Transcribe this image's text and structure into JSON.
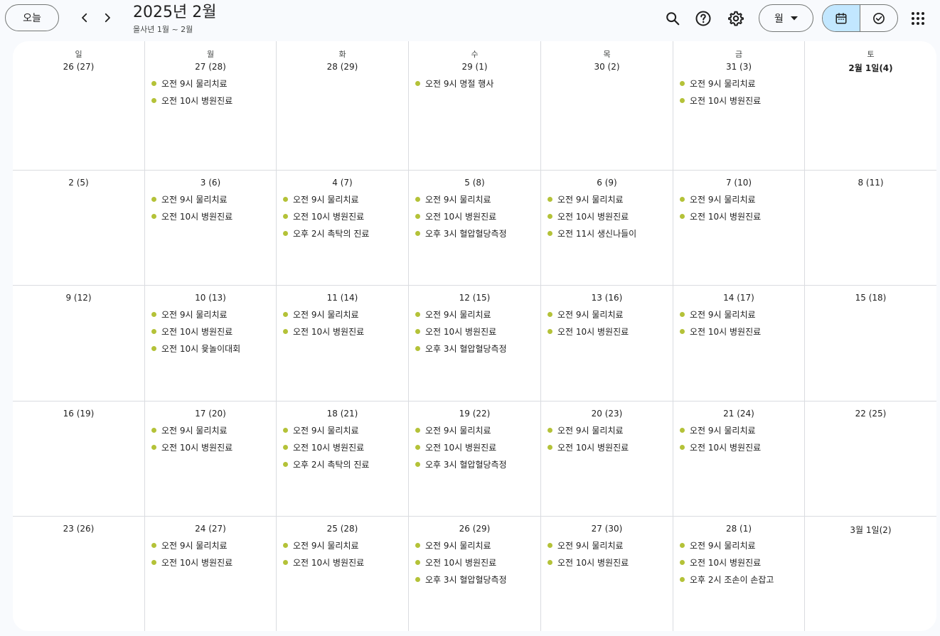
{
  "header": {
    "today_label": "오늘",
    "title": "2025년 2월",
    "subtitle": "을사년 1월 ~ 2월",
    "view_label": "월"
  },
  "colors": {
    "event_dot": "#b4c238",
    "active_segment": "#c2e7ff"
  },
  "icons": [
    "chevron-left-icon",
    "chevron-right-icon",
    "search-icon",
    "help-icon",
    "settings-icon",
    "dropdown-arrow-icon",
    "calendar-icon",
    "tasks-check-icon",
    "apps-grid-icon"
  ],
  "days_of_week": [
    "일",
    "월",
    "화",
    "수",
    "목",
    "금",
    "토"
  ],
  "weeks": [
    [
      {
        "date": "26 (27)",
        "events": []
      },
      {
        "date": "27 (28)",
        "events": [
          "오전 9시 물리치료",
          "오전 10시 병원진료"
        ]
      },
      {
        "date": "28 (29)",
        "events": []
      },
      {
        "date": "29 (1)",
        "events": [
          "오전 9시 명절 행사"
        ]
      },
      {
        "date": "30 (2)",
        "events": []
      },
      {
        "date": "31 (3)",
        "events": [
          "오전 9시 물리치료",
          "오전 10시 병원진료"
        ]
      },
      {
        "date": "2월 1일(4)",
        "events": [],
        "bold": true
      }
    ],
    [
      {
        "date": "2 (5)",
        "events": []
      },
      {
        "date": "3 (6)",
        "events": [
          "오전 9시 물리치료",
          "오전 10시 병원진료"
        ]
      },
      {
        "date": "4 (7)",
        "events": [
          "오전 9시 물리치료",
          "오전 10시 병원진료",
          "오후 2시 촉탁의 진료"
        ]
      },
      {
        "date": "5 (8)",
        "events": [
          "오전 9시 물리치료",
          "오전 10시 병원진료",
          "오후 3시 혈압혈당측정"
        ]
      },
      {
        "date": "6 (9)",
        "events": [
          "오전 9시 물리치료",
          "오전 10시 병원진료",
          "오전 11시 생신나들이"
        ]
      },
      {
        "date": "7 (10)",
        "events": [
          "오전 9시 물리치료",
          "오전 10시 병원진료"
        ]
      },
      {
        "date": "8 (11)",
        "events": []
      }
    ],
    [
      {
        "date": "9 (12)",
        "events": []
      },
      {
        "date": "10 (13)",
        "events": [
          "오전 9시 물리치료",
          "오전 10시 병원진료",
          "오전 10시 윷놀이대회"
        ]
      },
      {
        "date": "11 (14)",
        "events": [
          "오전 9시 물리치료",
          "오전 10시 병원진료"
        ]
      },
      {
        "date": "12 (15)",
        "events": [
          "오전 9시 물리치료",
          "오전 10시 병원진료",
          "오후 3시 혈압혈당측정"
        ]
      },
      {
        "date": "13 (16)",
        "events": [
          "오전 9시 물리치료",
          "오전 10시 병원진료"
        ]
      },
      {
        "date": "14 (17)",
        "events": [
          "오전 9시 물리치료",
          "오전 10시 병원진료"
        ]
      },
      {
        "date": "15 (18)",
        "events": []
      }
    ],
    [
      {
        "date": "16 (19)",
        "events": []
      },
      {
        "date": "17 (20)",
        "events": [
          "오전 9시 물리치료",
          "오전 10시 병원진료"
        ]
      },
      {
        "date": "18 (21)",
        "events": [
          "오전 9시 물리치료",
          "오전 10시 병원진료",
          "오후 2시 촉탁의 진료"
        ]
      },
      {
        "date": "19 (22)",
        "events": [
          "오전 9시 물리치료",
          "오전 10시 병원진료",
          "오후 3시 혈압혈당측정"
        ]
      },
      {
        "date": "20 (23)",
        "events": [
          "오전 9시 물리치료",
          "오전 10시 병원진료"
        ]
      },
      {
        "date": "21 (24)",
        "events": [
          "오전 9시 물리치료",
          "오전 10시 병원진료"
        ]
      },
      {
        "date": "22 (25)",
        "events": []
      }
    ],
    [
      {
        "date": "23 (26)",
        "events": []
      },
      {
        "date": "24 (27)",
        "events": [
          "오전 9시 물리치료",
          "오전 10시 병원진료"
        ]
      },
      {
        "date": "25 (28)",
        "events": [
          "오전 9시 물리치료",
          "오전 10시 병원진료"
        ]
      },
      {
        "date": "26 (29)",
        "events": [
          "오전 9시 물리치료",
          "오전 10시 병원진료",
          "오후 3시 혈압혈당측정"
        ]
      },
      {
        "date": "27 (30)",
        "events": [
          "오전 9시 물리치료",
          "오전 10시 병원진료"
        ]
      },
      {
        "date": "28 (1)",
        "events": [
          "오전 9시 물리치료",
          "오전 10시 병원진료",
          "오후 2시 조손이 손잡고"
        ]
      },
      {
        "date": "3월 1일(2)",
        "events": []
      }
    ]
  ]
}
